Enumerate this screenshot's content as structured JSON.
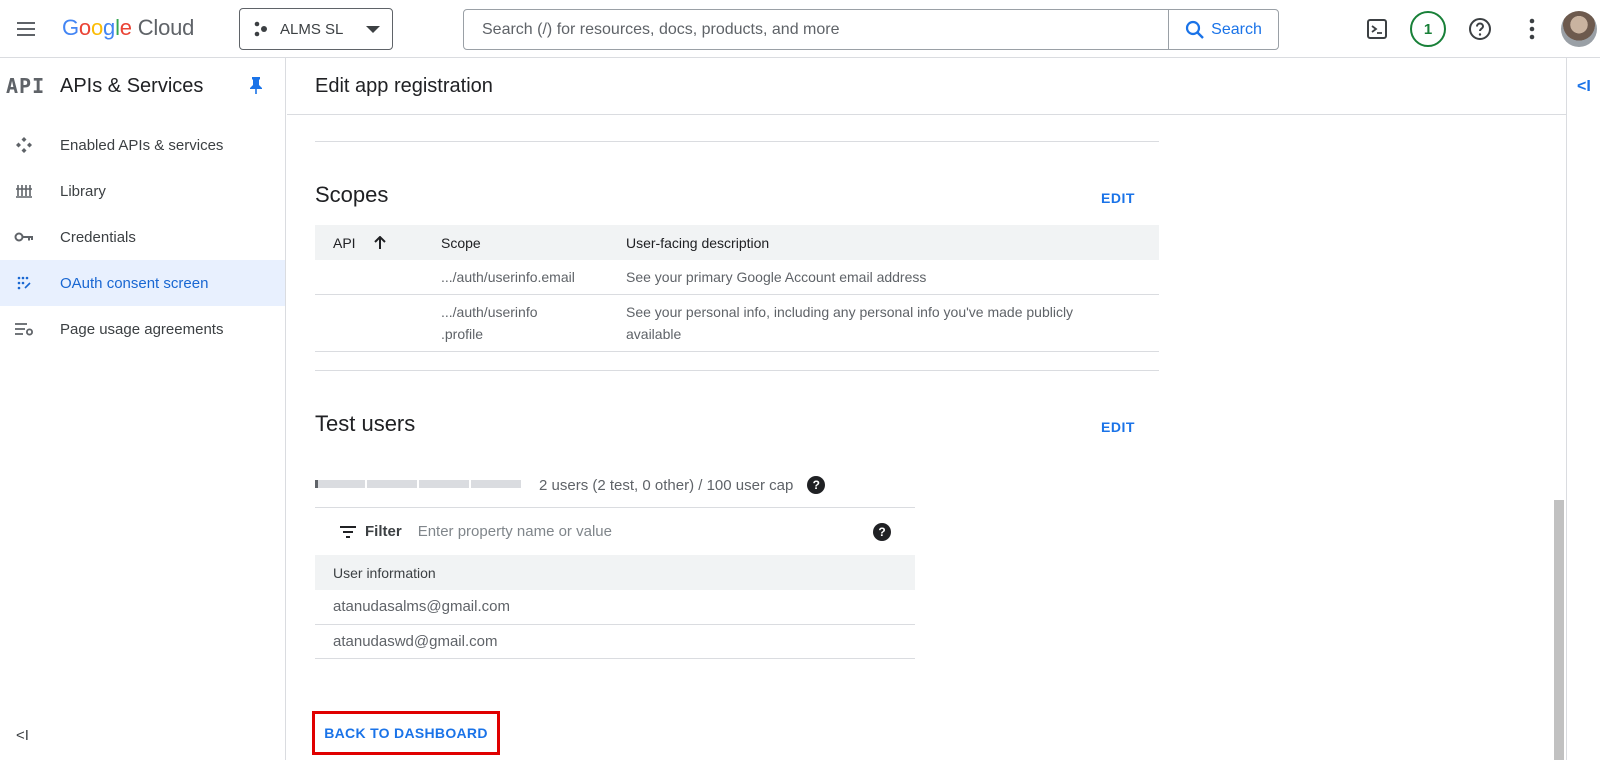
{
  "topbar": {
    "logo": {
      "g1": "G",
      "g2": "o",
      "g3": "o",
      "g4": "g",
      "g5": "l",
      "g6": "e",
      "cloud": " Cloud"
    },
    "project_name": "ALMS SL",
    "search_placeholder": "Search (/) for resources, docs, products, and more",
    "search_button": "Search",
    "notification_count": "1",
    "icons": [
      "menu-icon",
      "terminal-icon",
      "help-icon",
      "more-vert-icon"
    ]
  },
  "sidebar": {
    "badge": "API",
    "title": "APIs & Services",
    "items": [
      {
        "label": "Enabled APIs & services",
        "icon": "enabled-apis-icon",
        "active": false
      },
      {
        "label": "Library",
        "icon": "library-icon",
        "active": false
      },
      {
        "label": "Credentials",
        "icon": "key-icon",
        "active": false
      },
      {
        "label": "OAuth consent screen",
        "icon": "oauth-icon",
        "active": true
      },
      {
        "label": "Page usage agreements",
        "icon": "settings-list-icon",
        "active": false
      }
    ],
    "collapse_label": "<I"
  },
  "main": {
    "title": "Edit app registration",
    "rail_icon_label": "<I"
  },
  "scopes": {
    "title": "Scopes",
    "edit_label": "EDIT",
    "headers": {
      "api": "API",
      "scope": "Scope",
      "description": "User-facing description"
    },
    "rows": [
      {
        "api": "",
        "scope": ".../auth/userinfo.email",
        "description": "See your primary Google Account email address"
      },
      {
        "api": "",
        "scope": ".../auth/userinfo .profile",
        "description": "See your personal info, including any personal info you've made publicly available"
      }
    ]
  },
  "test_users": {
    "title": "Test users",
    "edit_label": "EDIT",
    "cap_text": "2 users (2 test, 0 other) / 100 user cap",
    "cap_used_fraction": 0.02,
    "filter_label": "Filter",
    "filter_placeholder": "Enter property name or value",
    "table_header": "User information",
    "users": [
      "atanudasalms@gmail.com",
      "atanudaswd@gmail.com"
    ]
  },
  "actions": {
    "back_label": "BACK TO DASHBOARD"
  },
  "colors": {
    "accent": "#1a73e8",
    "active_bg": "#e8f0fe",
    "highlight_border": "#e00000",
    "notification": "#188038"
  }
}
